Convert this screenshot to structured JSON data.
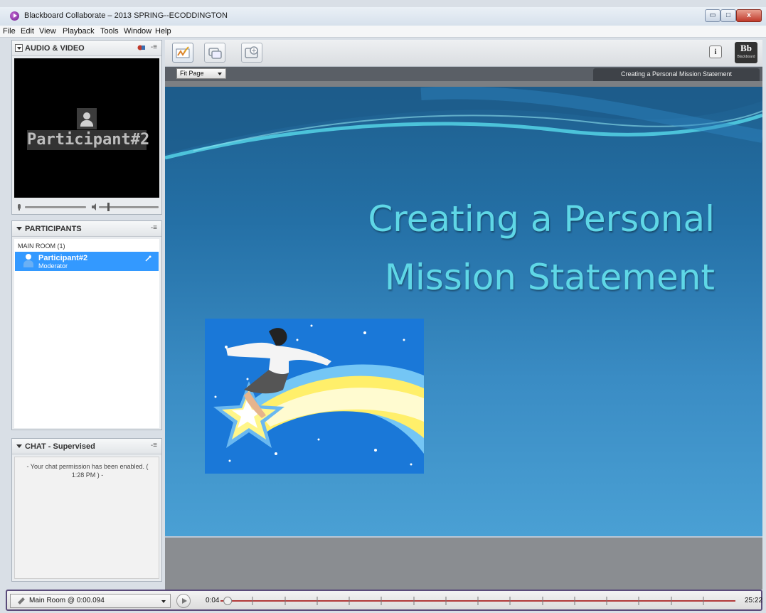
{
  "window": {
    "title": "Blackboard Collaborate – 2013 SPRING--ECODDINGTON",
    "minimize": "▭",
    "maximize": "□",
    "close": "x"
  },
  "menu": [
    "File",
    "Edit",
    "View",
    "Playback",
    "Tools",
    "Window",
    "Help"
  ],
  "audio_video": {
    "title": "AUDIO & VIDEO",
    "participant_label": "Participant#2"
  },
  "participants": {
    "title": "PARTICIPANTS",
    "room": "MAIN ROOM (1)",
    "list": [
      {
        "name": "Participant#2",
        "role": "Moderator"
      }
    ]
  },
  "chat": {
    "title": "CHAT - Supervised",
    "message": "- Your chat permission has been enabled. ( 1:28 PM ) -"
  },
  "toolbar": {
    "info": "i",
    "logo_text": "Bb",
    "logo_sub": "Blackboard"
  },
  "subbar": {
    "zoom": "Fit Page",
    "slide_title": "Creating a Personal Mission Statement"
  },
  "slide": {
    "heading_line1": "Creating a Personal",
    "heading_line2": "Mission Statement"
  },
  "playback": {
    "room": "Main Room @ 0:00.094",
    "current_time": "0:04",
    "total_time": "25:22",
    "progress": 0.003
  },
  "colors": {
    "accent": "#3399ff",
    "slide_title": "#5fd7e6",
    "playbar_border": "#5a4b7a"
  }
}
